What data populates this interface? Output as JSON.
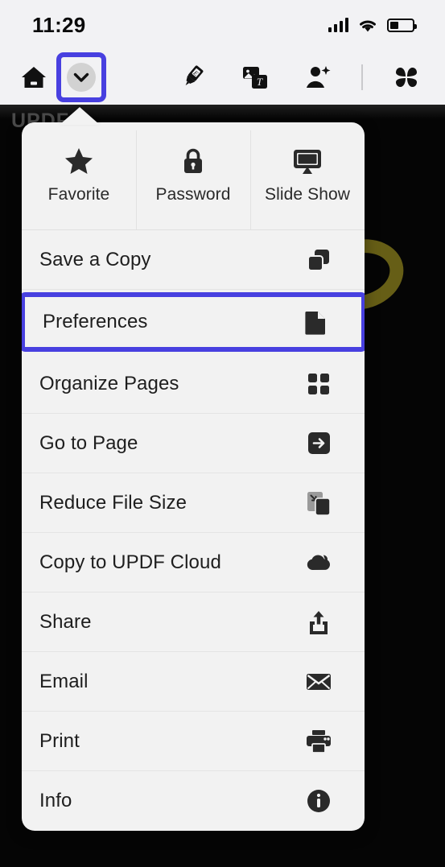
{
  "status_bar": {
    "time": "11:29",
    "signal_icon": "cellular-signal-icon",
    "wifi_icon": "wifi-icon",
    "battery_icon": "battery-icon",
    "battery_level_percent": 35
  },
  "toolbar": {
    "home_label": "home-icon",
    "chevron_label": "chevron-down-icon",
    "markup_label": "highlighter-icon",
    "edit_label": "edit-text-image-icon",
    "ai_label": "ai-portrait-icon",
    "grid_label": "apps-grid-icon"
  },
  "document": {
    "watermark": "UPDF"
  },
  "menu": {
    "header_buttons": [
      {
        "label": "Favorite",
        "icon": "star-icon"
      },
      {
        "label": "Password",
        "icon": "lock-icon"
      },
      {
        "label": "Slide Show",
        "icon": "presentation-screen-icon"
      }
    ],
    "items": [
      {
        "label": "Save a Copy",
        "icon": "copy-documents-icon",
        "highlighted": false
      },
      {
        "label": "Preferences",
        "icon": "document-page-icon",
        "highlighted": true
      },
      {
        "label": "Organize Pages",
        "icon": "grid-pages-icon",
        "highlighted": false
      },
      {
        "label": "Go to Page",
        "icon": "arrow-right-box-icon",
        "highlighted": false
      },
      {
        "label": "Reduce File Size",
        "icon": "compress-file-icon",
        "highlighted": false
      },
      {
        "label": "Copy to UPDF Cloud",
        "icon": "cloud-icon",
        "highlighted": false
      },
      {
        "label": "Share",
        "icon": "share-upload-icon",
        "highlighted": false
      },
      {
        "label": "Email",
        "icon": "envelope-icon",
        "highlighted": false
      },
      {
        "label": "Print",
        "icon": "printer-icon",
        "highlighted": false
      },
      {
        "label": "Info",
        "icon": "info-circle-icon",
        "highlighted": false
      }
    ]
  },
  "colors": {
    "highlight_blue": "#4840e0",
    "menu_background": "#f2f2f2",
    "chrome_background": "#f2f2f4",
    "document_background": "#050505",
    "accent_olive": "#6f6618"
  }
}
